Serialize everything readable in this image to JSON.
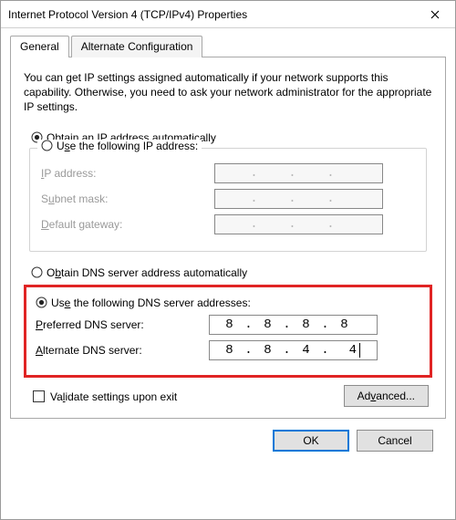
{
  "window": {
    "title": "Internet Protocol Version 4 (TCP/IPv4) Properties"
  },
  "tabs": {
    "general": "General",
    "alternate": "Alternate Configuration"
  },
  "intro": "You can get IP settings assigned automatically if your network supports this capability. Otherwise, you need to ask your network administrator for the appropriate IP settings.",
  "ip_section": {
    "auto_label_pre": "",
    "auto_u": "O",
    "auto_label_post": "btain an IP address automatically",
    "manual_pre": "U",
    "manual_u": "s",
    "manual_post": "e the following IP address:",
    "fields": {
      "ip_pre": "",
      "ip_u": "I",
      "ip_post": "P address:",
      "mask_pre": "S",
      "mask_u": "u",
      "mask_post": "bnet mask:",
      "gw_pre": "",
      "gw_u": "D",
      "gw_post": "efault gateway:"
    }
  },
  "dns_section": {
    "auto_pre": "O",
    "auto_u": "b",
    "auto_post": "tain DNS server address automatically",
    "manual_pre": "Us",
    "manual_u": "e",
    "manual_post": " the following DNS server addresses:",
    "fields": {
      "pref_pre": "",
      "pref_u": "P",
      "pref_post": "referred DNS server:",
      "alt_pre": "",
      "alt_u": "A",
      "alt_post": "lternate DNS server:"
    },
    "values": {
      "preferred": [
        "8",
        "8",
        "8",
        "8"
      ],
      "alternate": [
        "8",
        "8",
        "4",
        "4"
      ]
    }
  },
  "validate": {
    "pre": "Va",
    "u": "l",
    "post": "idate settings upon exit"
  },
  "buttons": {
    "advanced_pre": "Ad",
    "advanced_u": "v",
    "advanced_post": "anced...",
    "ok": "OK",
    "cancel": "Cancel"
  }
}
